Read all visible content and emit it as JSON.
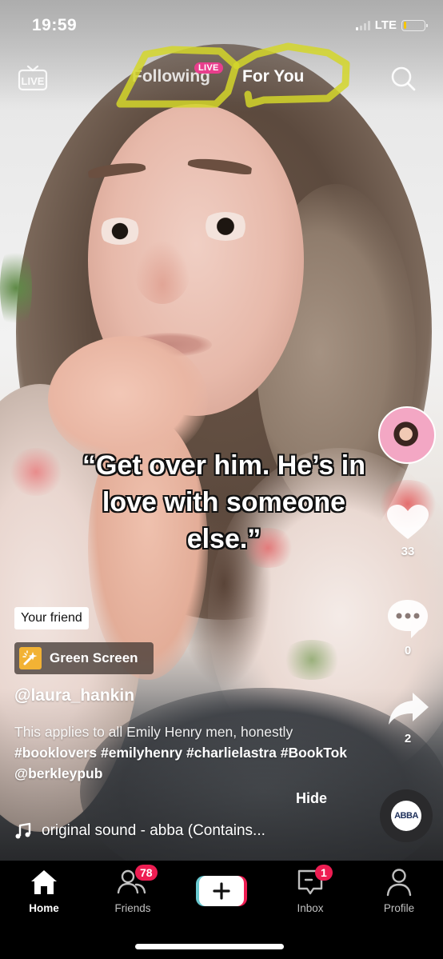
{
  "status_bar": {
    "time": "19:59",
    "network": "LTE",
    "signal_bars_active": 1,
    "signal_bars_total": 4,
    "battery_level": 0.15,
    "battery_color": "#f7c600"
  },
  "top_nav": {
    "live_icon_label": "LIVE",
    "tabs": [
      {
        "label": "Following",
        "active": false,
        "badge": "LIVE"
      },
      {
        "label": "For You",
        "active": true
      }
    ],
    "live_badge_color": "#e83e8c",
    "highlight_color": "#d4d62a",
    "search_icon": "search-icon"
  },
  "video": {
    "overlay_lines": [
      "“Get over him. He’s in",
      "love with someone",
      "else.”"
    ],
    "friend_tag": "Your friend",
    "effect": {
      "label": "Green Screen",
      "icon": "magic-wand-icon",
      "icon_color": "#f2b234"
    },
    "username": "@laura_hankin",
    "description": {
      "plain": "This applies to all Emily Henry men, honestly ",
      "tags": [
        "#booklovers",
        "#emilyhenry",
        "#charlielastra",
        "#BookTok",
        "@berkleypub"
      ]
    },
    "hide_label": "Hide",
    "sound": "original sound - abba (Contains...",
    "sound_disc_label": "ABBA"
  },
  "right_rail": {
    "likes": "33",
    "comments": "0",
    "shares": "2"
  },
  "tab_bar": {
    "items": [
      {
        "label": "Home",
        "icon": "home-icon",
        "active": true
      },
      {
        "label": "Friends",
        "icon": "friends-icon",
        "badge": "78"
      },
      {
        "label": "",
        "icon": "create-plus-icon"
      },
      {
        "label": "Inbox",
        "icon": "inbox-icon",
        "badge": "1"
      },
      {
        "label": "Profile",
        "icon": "profile-icon"
      }
    ],
    "badge_color": "#ee1d52"
  }
}
